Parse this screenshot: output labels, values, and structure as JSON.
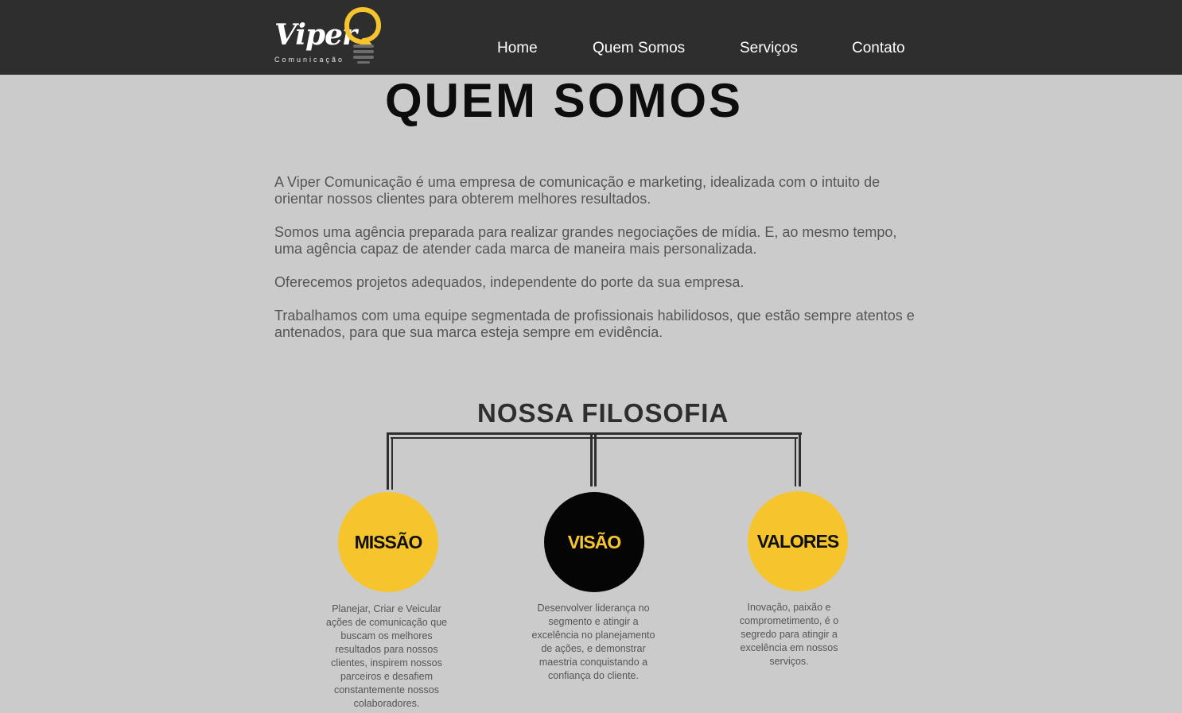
{
  "header": {
    "logo": {
      "word": "Viper",
      "subtitle": "Comunicação"
    },
    "nav": [
      {
        "label": "Home"
      },
      {
        "label": "Quem Somos"
      },
      {
        "label": "Serviços"
      },
      {
        "label": "Contato"
      }
    ]
  },
  "main": {
    "title": "QUEM SOMOS",
    "paragraphs": [
      "A Viper Comunicação é uma empresa de comunicação e marketing, idealizada com o intuito de orientar nossos clientes para obterem melhores resultados.",
      "Somos uma agência preparada para realizar grandes negociações de mídia. E, ao mesmo tempo, uma agência capaz de atender cada marca de maneira mais personalizada.",
      "Oferecemos projetos adequados, independente do porte da sua empresa.",
      "Trabalhamos com uma equipe segmentada de profissionais habilidosos, que estão sempre atentos e antenados, para que sua marca esteja sempre em evidência."
    ]
  },
  "philosophy": {
    "title": "NOSSA FILOSOFIA",
    "items": [
      {
        "label": "MISSÃO",
        "text": "Planejar, Criar e Veicular ações de comunicação que buscam os melhores resultados para nossos clientes, inspirem nossos parceiros e desafiem constantemente nossos colaboradores."
      },
      {
        "label": "VISÃO",
        "text": "Desenvolver liderança no segmento e atingir a excelência no planejamento de ações, e demonstrar maestria conquistando a confiança do cliente."
      },
      {
        "label": "VALORES",
        "text": "Inovação, paixão e comprometimento, é o segredo para atingir a excelência  em nossos serviços."
      }
    ]
  },
  "colors": {
    "header_bg": "#2e2e2e",
    "page_bg": "#cbcbcb",
    "accent_yellow": "#f6c52e",
    "black": "#050505"
  }
}
